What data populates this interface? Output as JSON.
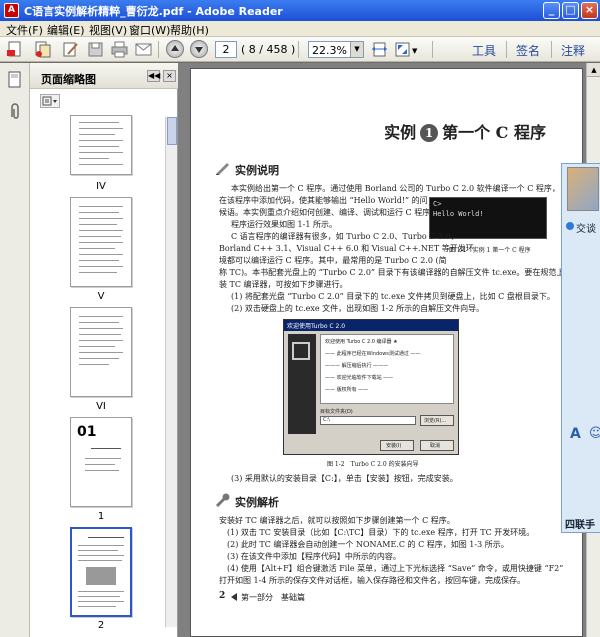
{
  "window": {
    "title": "C语言实例解析精粹_曹衍龙.pdf - Adobe Reader",
    "app_icon_label": "A",
    "minimize": "_",
    "maximize": "□",
    "close": "×"
  },
  "menu": [
    "文件(F)",
    "编辑(E)",
    "视图(V)",
    "窗口(W)",
    "帮助(H)"
  ],
  "toolbar": {
    "page_current": "2",
    "page_total": "( 8 / 458 )",
    "zoom": "22.3%",
    "links": [
      "工具",
      "签名",
      "注释"
    ]
  },
  "thumbnails_panel": {
    "title": "页面缩略图",
    "thumb_labels": [
      "IV",
      "V",
      "VI",
      "1",
      "2"
    ],
    "thumb1_big_text": "01"
  },
  "document": {
    "chapter_label_left": "实例",
    "chapter_num": "1",
    "chapter_title": "第一个 C 程序",
    "section1": "实例说明",
    "para1": [
      "本实例给出第一个 C 程序。通过使用 Borland 公司的 Turbo C 2.0 软件编译一个 C 程序，",
      "在该程序中添加代码，使其能够输出 “Hello World!” 的问",
      "候语。本实例重点介绍如何创建、编译、调试和运行 C 程序。",
      "程序运行效果如图 1-1 所示。"
    ],
    "figure1_lines": [
      "C>",
      "Hello World!"
    ],
    "figure1_caption": "图 1-1　实例 1 第一个 C 程序",
    "para2": [
      "C 语言程序的编译器有很多，如 Turbo C 2.0、Turbo C 3.0、",
      "Borland C++ 3.1、Visual C++ 6.0 和 Visual C++.NET 等开发环",
      "境都可以编译运行 C 程序。其中，最常用的是 Turbo C 2.0 (简",
      "称 TC)。本书配套光盘上的 “Turbo C 2.0” 目录下有该编译器的自解压文件 tc.exe。要在规范上安",
      "装 TC 编译器，可按如下步骤进行。",
      "(1) 将配套光盘 “Turbo C 2.0” 目录下的 tc.exe 文件拷贝到硬盘上，比如 C 盘根目录下。",
      "(2) 双击硬盘上的 tc.exe 文件，出现如图 1-2 所示的自解压文件向导。"
    ],
    "dialog_title": "欢迎使用Turbo C 2.0",
    "dialog_lines": [
      "欢迎使用 Turbo C 2.0 编译器  ★",
      "—— 此程序已经在Windows测试通过 ——",
      "——— 解压缩后执行 ———",
      "—— 欢迎光临软件下载站 ——",
      "—— 版权所有 ——"
    ],
    "dialog_label": "目标文件夹(D)",
    "dialog_value": "C:\\",
    "dialog_browse": "浏览(R)...",
    "dialog_ok": "安装(I)",
    "dialog_cancel": "取消",
    "figure2_caption": "图 1-2　Turbo C 2.0 的安装向导",
    "para3": "(3) 采用默认的安装目录【C:】，单击【安装】按钮，完成安装。",
    "section2": "实例解析",
    "para4": [
      "安装好 TC 编译器之后，就可以按照如下步骤创建第一个 C 程序。",
      "(1) 双击 TC 安装目录（比如【C:\\TC】目录）下的 tc.exe 程序，打开 TC 开发环境。",
      "(2) 此时 TC 编译器会自动创建一个 NONAME.C 的 C 程序，如图 1-3 所示。",
      "(3) 在该文件中添加【程序代码】中所示的内容。",
      "(4) 使用【Alt+F】组合键激活 File 菜单，通过上下光标选择 “Save” 命令，或用快捷键 “F2”",
      "打开如图 1-4 所示的保存文件对话框，输入保存路径和文件名，按回车键，完成保存。"
    ],
    "footer_page": "2",
    "footer_text": "第一部分　基础篇"
  },
  "chat_panel": {
    "invite": "交谈",
    "font_a": "A",
    "smile": "☺",
    "bottom": "四联手"
  }
}
